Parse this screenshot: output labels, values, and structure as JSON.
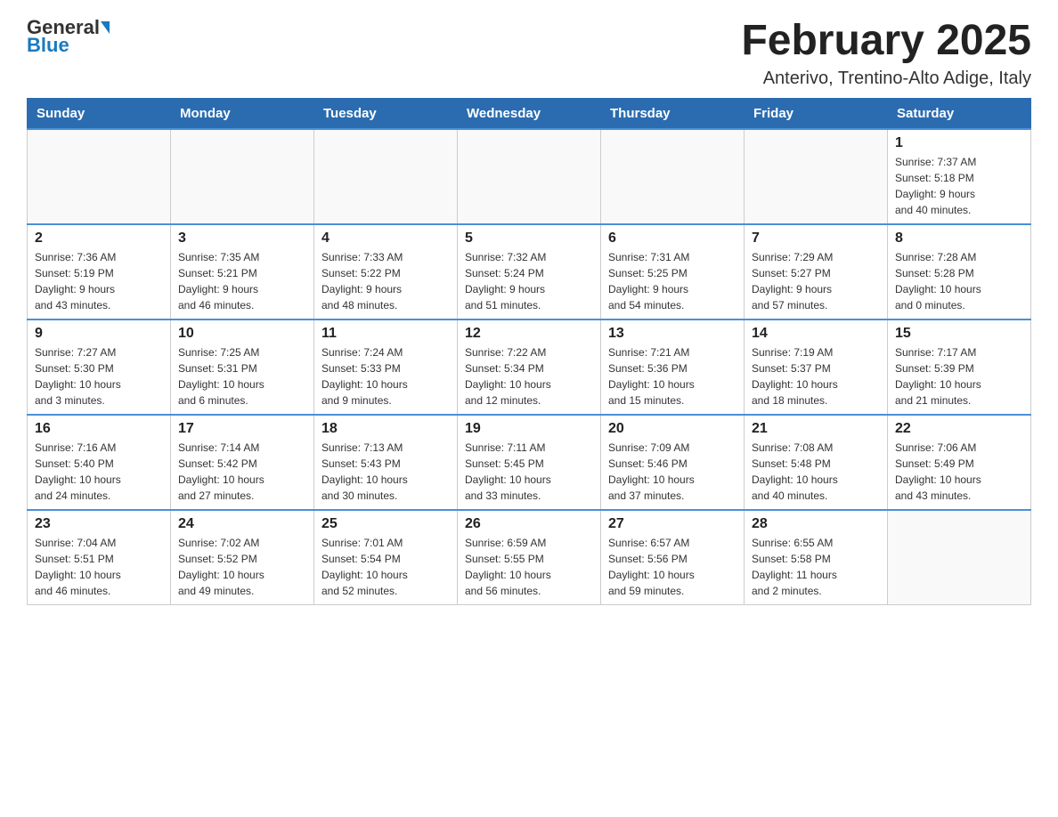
{
  "header": {
    "logo_general": "General",
    "logo_blue": "Blue",
    "title": "February 2025",
    "subtitle": "Anterivo, Trentino-Alto Adige, Italy"
  },
  "calendar": {
    "days_of_week": [
      "Sunday",
      "Monday",
      "Tuesday",
      "Wednesday",
      "Thursday",
      "Friday",
      "Saturday"
    ],
    "weeks": [
      [
        {
          "day": "",
          "info": ""
        },
        {
          "day": "",
          "info": ""
        },
        {
          "day": "",
          "info": ""
        },
        {
          "day": "",
          "info": ""
        },
        {
          "day": "",
          "info": ""
        },
        {
          "day": "",
          "info": ""
        },
        {
          "day": "1",
          "info": "Sunrise: 7:37 AM\nSunset: 5:18 PM\nDaylight: 9 hours\nand 40 minutes."
        }
      ],
      [
        {
          "day": "2",
          "info": "Sunrise: 7:36 AM\nSunset: 5:19 PM\nDaylight: 9 hours\nand 43 minutes."
        },
        {
          "day": "3",
          "info": "Sunrise: 7:35 AM\nSunset: 5:21 PM\nDaylight: 9 hours\nand 46 minutes."
        },
        {
          "day": "4",
          "info": "Sunrise: 7:33 AM\nSunset: 5:22 PM\nDaylight: 9 hours\nand 48 minutes."
        },
        {
          "day": "5",
          "info": "Sunrise: 7:32 AM\nSunset: 5:24 PM\nDaylight: 9 hours\nand 51 minutes."
        },
        {
          "day": "6",
          "info": "Sunrise: 7:31 AM\nSunset: 5:25 PM\nDaylight: 9 hours\nand 54 minutes."
        },
        {
          "day": "7",
          "info": "Sunrise: 7:29 AM\nSunset: 5:27 PM\nDaylight: 9 hours\nand 57 minutes."
        },
        {
          "day": "8",
          "info": "Sunrise: 7:28 AM\nSunset: 5:28 PM\nDaylight: 10 hours\nand 0 minutes."
        }
      ],
      [
        {
          "day": "9",
          "info": "Sunrise: 7:27 AM\nSunset: 5:30 PM\nDaylight: 10 hours\nand 3 minutes."
        },
        {
          "day": "10",
          "info": "Sunrise: 7:25 AM\nSunset: 5:31 PM\nDaylight: 10 hours\nand 6 minutes."
        },
        {
          "day": "11",
          "info": "Sunrise: 7:24 AM\nSunset: 5:33 PM\nDaylight: 10 hours\nand 9 minutes."
        },
        {
          "day": "12",
          "info": "Sunrise: 7:22 AM\nSunset: 5:34 PM\nDaylight: 10 hours\nand 12 minutes."
        },
        {
          "day": "13",
          "info": "Sunrise: 7:21 AM\nSunset: 5:36 PM\nDaylight: 10 hours\nand 15 minutes."
        },
        {
          "day": "14",
          "info": "Sunrise: 7:19 AM\nSunset: 5:37 PM\nDaylight: 10 hours\nand 18 minutes."
        },
        {
          "day": "15",
          "info": "Sunrise: 7:17 AM\nSunset: 5:39 PM\nDaylight: 10 hours\nand 21 minutes."
        }
      ],
      [
        {
          "day": "16",
          "info": "Sunrise: 7:16 AM\nSunset: 5:40 PM\nDaylight: 10 hours\nand 24 minutes."
        },
        {
          "day": "17",
          "info": "Sunrise: 7:14 AM\nSunset: 5:42 PM\nDaylight: 10 hours\nand 27 minutes."
        },
        {
          "day": "18",
          "info": "Sunrise: 7:13 AM\nSunset: 5:43 PM\nDaylight: 10 hours\nand 30 minutes."
        },
        {
          "day": "19",
          "info": "Sunrise: 7:11 AM\nSunset: 5:45 PM\nDaylight: 10 hours\nand 33 minutes."
        },
        {
          "day": "20",
          "info": "Sunrise: 7:09 AM\nSunset: 5:46 PM\nDaylight: 10 hours\nand 37 minutes."
        },
        {
          "day": "21",
          "info": "Sunrise: 7:08 AM\nSunset: 5:48 PM\nDaylight: 10 hours\nand 40 minutes."
        },
        {
          "day": "22",
          "info": "Sunrise: 7:06 AM\nSunset: 5:49 PM\nDaylight: 10 hours\nand 43 minutes."
        }
      ],
      [
        {
          "day": "23",
          "info": "Sunrise: 7:04 AM\nSunset: 5:51 PM\nDaylight: 10 hours\nand 46 minutes."
        },
        {
          "day": "24",
          "info": "Sunrise: 7:02 AM\nSunset: 5:52 PM\nDaylight: 10 hours\nand 49 minutes."
        },
        {
          "day": "25",
          "info": "Sunrise: 7:01 AM\nSunset: 5:54 PM\nDaylight: 10 hours\nand 52 minutes."
        },
        {
          "day": "26",
          "info": "Sunrise: 6:59 AM\nSunset: 5:55 PM\nDaylight: 10 hours\nand 56 minutes."
        },
        {
          "day": "27",
          "info": "Sunrise: 6:57 AM\nSunset: 5:56 PM\nDaylight: 10 hours\nand 59 minutes."
        },
        {
          "day": "28",
          "info": "Sunrise: 6:55 AM\nSunset: 5:58 PM\nDaylight: 11 hours\nand 2 minutes."
        },
        {
          "day": "",
          "info": ""
        }
      ]
    ]
  }
}
